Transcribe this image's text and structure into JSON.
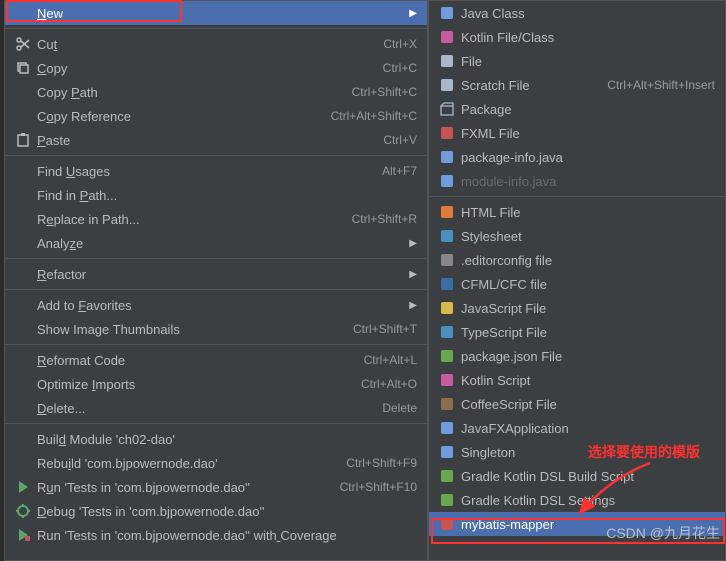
{
  "left_menu": [
    {
      "key": "new",
      "label": "New",
      "shortcut": "",
      "arrow": true,
      "icon": "",
      "selected": true,
      "underline": 0
    },
    {
      "sep": true
    },
    {
      "key": "cut",
      "label": "Cut",
      "shortcut": "Ctrl+X",
      "icon": "scissors",
      "underline": 2
    },
    {
      "key": "copy",
      "label": "Copy",
      "shortcut": "Ctrl+C",
      "icon": "copy",
      "underline": 0
    },
    {
      "key": "copy-path",
      "label": "Copy Path",
      "shortcut": "Ctrl+Shift+C",
      "underline": 5
    },
    {
      "key": "copy-reference",
      "label": "Copy Reference",
      "shortcut": "Ctrl+Alt+Shift+C",
      "underline": 1
    },
    {
      "key": "paste",
      "label": "Paste",
      "shortcut": "Ctrl+V",
      "icon": "paste",
      "underline": 0
    },
    {
      "sep": true
    },
    {
      "key": "find-usages",
      "label": "Find Usages",
      "shortcut": "Alt+F7",
      "underline": 5
    },
    {
      "key": "find-in-path",
      "label": "Find in Path...",
      "shortcut": "",
      "underline": 8
    },
    {
      "key": "replace-in-path",
      "label": "Replace in Path...",
      "shortcut": "Ctrl+Shift+R",
      "underline": 1
    },
    {
      "key": "analyze",
      "label": "Analyze",
      "shortcut": "",
      "arrow": true,
      "underline": 5
    },
    {
      "sep": true
    },
    {
      "key": "refactor",
      "label": "Refactor",
      "shortcut": "",
      "arrow": true,
      "underline": 0
    },
    {
      "sep": true
    },
    {
      "key": "add-favorites",
      "label": "Add to Favorites",
      "shortcut": "",
      "arrow": true,
      "underline": 7
    },
    {
      "key": "show-thumbnails",
      "label": "Show Image Thumbnails",
      "shortcut": "Ctrl+Shift+T"
    },
    {
      "sep": true
    },
    {
      "key": "reformat",
      "label": "Reformat Code",
      "shortcut": "Ctrl+Alt+L",
      "underline": 0
    },
    {
      "key": "optimize-imports",
      "label": "Optimize Imports",
      "shortcut": "Ctrl+Alt+O",
      "underline": 9
    },
    {
      "key": "delete",
      "label": "Delete...",
      "shortcut": "Delete",
      "underline": 0
    },
    {
      "sep": true
    },
    {
      "key": "build-module",
      "label": "Build Module 'ch02-dao'",
      "shortcut": "",
      "underline": 4
    },
    {
      "key": "rebuild",
      "label": "Rebuild 'com.bjpowernode.dao'",
      "shortcut": "Ctrl+Shift+F9",
      "underline": 4
    },
    {
      "key": "run-tests",
      "label": "Run 'Tests in 'com.bjpowernode.dao''",
      "shortcut": "Ctrl+Shift+F10",
      "icon": "run",
      "underline": 1
    },
    {
      "key": "debug-tests",
      "label": "Debug 'Tests in 'com.bjpowernode.dao''",
      "shortcut": "",
      "icon": "debug",
      "underline": 0
    },
    {
      "key": "run-coverage",
      "label": "Run 'Tests in 'com.bjpowernode.dao'' with Coverage",
      "shortcut": "",
      "icon": "coverage",
      "underline": 41
    }
  ],
  "right_menu": [
    {
      "key": "java-class",
      "label": "Java Class",
      "icon": "java-class"
    },
    {
      "key": "kotlin-file",
      "label": "Kotlin File/Class",
      "icon": "kotlin"
    },
    {
      "key": "file",
      "label": "File",
      "icon": "file"
    },
    {
      "key": "scratch-file",
      "label": "Scratch File",
      "shortcut": "Ctrl+Alt+Shift+Insert",
      "icon": "scratch"
    },
    {
      "key": "package",
      "label": "Package",
      "icon": "package"
    },
    {
      "key": "fxml",
      "label": "FXML File",
      "icon": "fxml"
    },
    {
      "key": "package-info",
      "label": "package-info.java",
      "icon": "java-file"
    },
    {
      "key": "module-info",
      "label": "module-info.java",
      "icon": "java-file",
      "disabled": true
    },
    {
      "sep": true
    },
    {
      "key": "html-file",
      "label": "HTML File",
      "icon": "html"
    },
    {
      "key": "stylesheet",
      "label": "Stylesheet",
      "icon": "css"
    },
    {
      "key": "editorconfig",
      "label": ".editorconfig file",
      "icon": "editorconfig"
    },
    {
      "key": "cfml",
      "label": "CFML/CFC file",
      "icon": "cfml"
    },
    {
      "key": "js-file",
      "label": "JavaScript File",
      "icon": "js"
    },
    {
      "key": "ts-file",
      "label": "TypeScript File",
      "icon": "ts"
    },
    {
      "key": "package-json",
      "label": "package.json File",
      "icon": "npm"
    },
    {
      "key": "kotlin-script",
      "label": "Kotlin Script",
      "icon": "kotlin"
    },
    {
      "key": "coffee-file",
      "label": "CoffeeScript File",
      "icon": "coffee"
    },
    {
      "key": "javafx-app",
      "label": "JavaFXApplication",
      "icon": "java-class"
    },
    {
      "key": "singleton",
      "label": "Singleton",
      "icon": "java-class"
    },
    {
      "key": "gradle-build",
      "label": "Gradle Kotlin DSL Build Script",
      "icon": "gradle"
    },
    {
      "key": "gradle-settings",
      "label": "Gradle Kotlin DSL Settings",
      "icon": "gradle"
    },
    {
      "key": "mybatis-mapper",
      "label": "mybatis-mapper",
      "icon": "xml",
      "selected": true
    }
  ],
  "annotation": "选择要使用的模版",
  "watermark": "CSDN @九月花生"
}
